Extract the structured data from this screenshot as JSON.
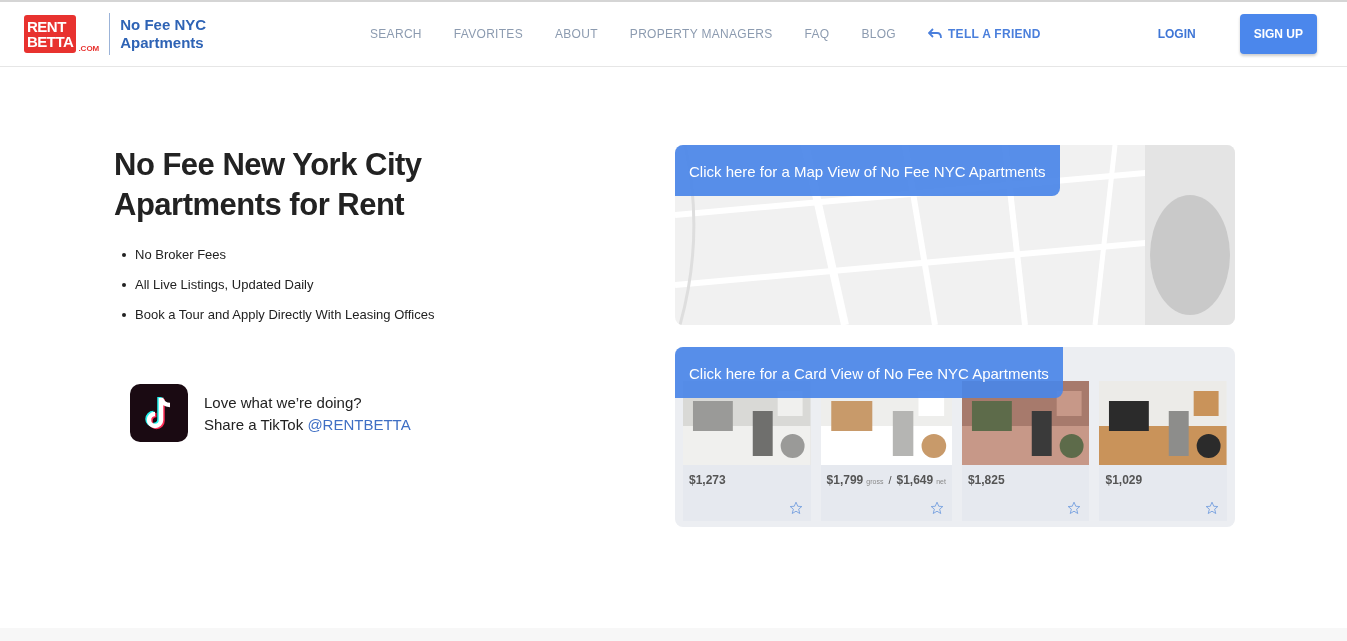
{
  "header": {
    "logo": {
      "line_1": "RENT",
      "line_2": "BETTA",
      "suffix": ".COM"
    },
    "tagline": "No Fee NYC Apartments",
    "nav": [
      {
        "label": "SEARCH",
        "kind": "plain"
      },
      {
        "label": "FAVORITES",
        "kind": "plain"
      },
      {
        "label": "ABOUT",
        "kind": "plain"
      },
      {
        "label": "PROPERTY MANAGERS",
        "kind": "plain"
      },
      {
        "label": "FAQ",
        "kind": "plain"
      },
      {
        "label": "BLOG",
        "kind": "plain"
      },
      {
        "label": "TELL A FRIEND",
        "kind": "share"
      }
    ],
    "login": "LOGIN",
    "signup": "SIGN UP"
  },
  "hero": {
    "title": "No Fee New York City Apartments for Rent",
    "bullets": [
      "No Broker Fees",
      "All Live Listings, Updated Daily",
      "Book a Tour and Apply Directly With Leasing Offices"
    ],
    "tiktok": {
      "line_1": "Love what we’re doing?",
      "line_2": "Share a TikTok",
      "handle": "@RENTBETTA"
    }
  },
  "map_view": {
    "link": "Click here for a Map View of No Fee NYC Apartments"
  },
  "card_view": {
    "link": "Click here for a Card View of No Fee NYC Apartments",
    "cards": [
      {
        "prices": [
          {
            "amount": "$1,273"
          }
        ]
      },
      {
        "prices": [
          {
            "amount": "$1,799",
            "suffix": "gross"
          },
          {
            "separator": "/",
            "amount": "$1,649",
            "suffix": "net"
          }
        ]
      },
      {
        "prices": [
          {
            "amount": "$1,825"
          }
        ]
      },
      {
        "prices": [
          {
            "amount": "$1,029"
          }
        ]
      }
    ]
  }
}
